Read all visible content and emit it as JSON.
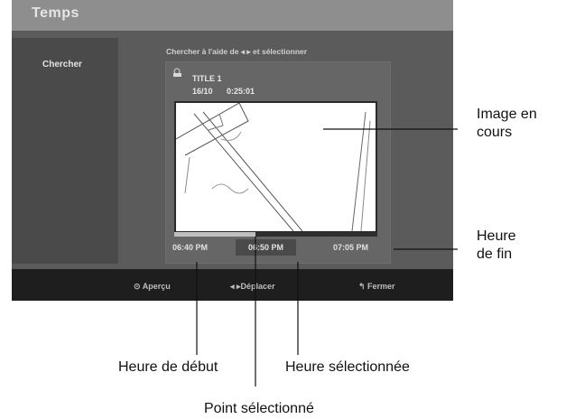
{
  "window": {
    "title": "Temps"
  },
  "sidebar": {
    "items": [
      {
        "label": "Chercher"
      }
    ]
  },
  "instruction": "Chercher à l'aide de ◂ ▸ et sélectionner",
  "title_info": {
    "title": "TITLE 1",
    "date": "16/10",
    "duration": "0:25:01",
    "icon": "disc-icon"
  },
  "times": {
    "start": "06:40 PM",
    "selected": "06:50 PM",
    "end": "07:05 PM"
  },
  "progress": {
    "selected_fraction": 0.4
  },
  "footer": {
    "preview": "Aperçu",
    "move": "Déplacer",
    "close": "Fermer",
    "preview_icon": "circle-button-icon",
    "move_icon": "arrow-left-right-icon",
    "close_icon": "return-icon"
  },
  "callouts": {
    "current_image": "Image en\ncours",
    "end_time": "Heure\nde fin",
    "start_time": "Heure de début",
    "selected_time": "Heure sélectionnée",
    "selected_point": "Point sélectionné"
  },
  "colors": {
    "screen_bg": "#5b5b5b",
    "titlebar": "#8e8e8e",
    "footer_bg": "#1e1e1e"
  }
}
